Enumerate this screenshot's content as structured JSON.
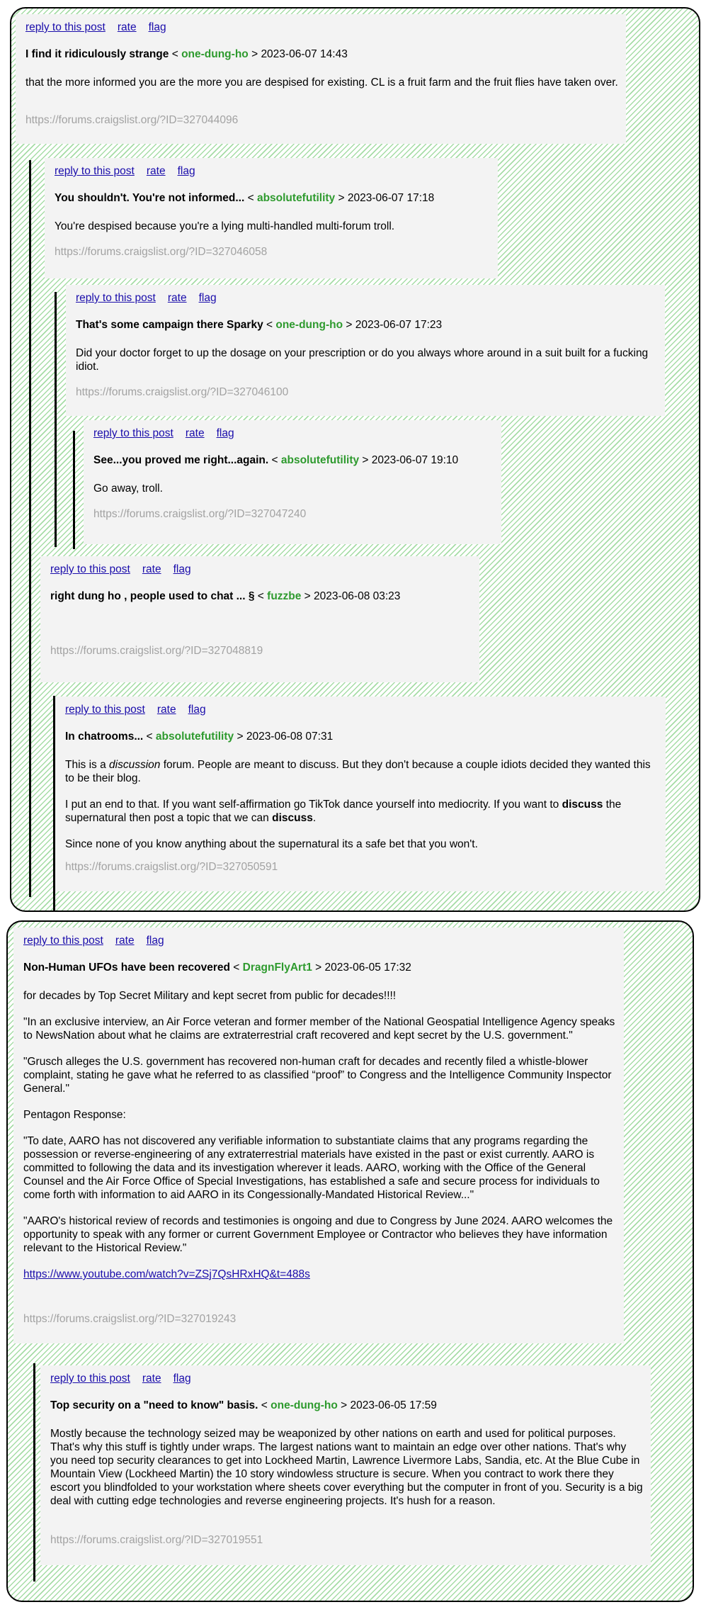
{
  "actions": {
    "reply": "reply to this post",
    "rate": "rate",
    "flag": "flag"
  },
  "threads": [
    {
      "posts": [
        {
          "title": "I find it ridiculously strange",
          "author": "one-dung-ho",
          "datetime": "2023-06-07 14:43",
          "paragraphs": [
            "that the more informed you are the more you are despised for existing. CL is a fruit farm and the fruit flies have taken over."
          ],
          "url": "https://forums.craigslist.org/?ID=327044096"
        },
        {
          "title": "You shouldn't. You're not informed...",
          "author": "absolutefutility",
          "datetime": "2023-06-07 17:18",
          "paragraphs": [
            "You're despised because you're a lying multi-handled multi-forum troll."
          ],
          "url": "https://forums.craigslist.org/?ID=327046058"
        },
        {
          "title": "That's some campaign there Sparky",
          "author": "one-dung-ho",
          "datetime": "2023-06-07 17:23",
          "paragraphs": [
            "Did your doctor forget to up the dosage on your prescription or do you always whore around in a suit built for a fucking idiot."
          ],
          "url": "https://forums.craigslist.org/?ID=327046100"
        },
        {
          "title": "See...you proved me right...again.",
          "author": "absolutefutility",
          "datetime": "2023-06-07 19:10",
          "paragraphs": [
            "Go away, troll."
          ],
          "url": "https://forums.craigslist.org/?ID=327047240"
        },
        {
          "title": "right dung ho , people used to chat ... §",
          "author": "fuzzbe",
          "datetime": "2023-06-08 03:23",
          "paragraphs": [],
          "url": "https://forums.craigslist.org/?ID=327048819"
        },
        {
          "title": "In chatrooms...",
          "author": "absolutefutility",
          "datetime": "2023-06-08 07:31",
          "p1_pre": "This is a ",
          "p1_em": "discussion",
          "p1_post": " forum. People are meant to discuss. But they don't because a couple idiots decided they wanted this to be their blog.",
          "p2_a": "I put an end to that. If you want self-affirmation go TikTok dance yourself into mediocrity. If you want to ",
          "p2_b1": "discuss",
          "p2_c": " the supernatural then post a topic that we can ",
          "p2_b2": "discuss",
          "p2_d": ".",
          "p3": "Since none of you know anything about the supernatural its a safe bet that you won't.",
          "url": "https://forums.craigslist.org/?ID=327050591"
        }
      ]
    },
    {
      "posts": [
        {
          "title": "Non-Human UFOs have been recovered",
          "author": "DragnFlyArt1",
          "datetime": "2023-06-05 17:32",
          "paragraphs": [
            "for decades by Top Secret Military and kept secret from public for decades!!!!",
            "\"In an exclusive interview, an Air Force veteran and former member of the National Geospatial Intelligence Agency speaks to NewsNation about what he claims are extraterrestrial craft recovered and kept secret by the U.S. government.\"",
            "\"Grusch alleges the U.S. government has recovered non-human craft for decades and recently filed a whistle-blower complaint, stating he gave what he referred to as classified “proof” to Congress and the Intelligence Community Inspector General.\"",
            "Pentagon Response:",
            "\"To date, AARO has not discovered any verifiable information to substantiate claims that any programs regarding the possession or reverse-engineering of any extraterrestrial materials have existed in the past or exist currently. AARO is committed to following the data and its investigation wherever it leads. AARO, working with the Office of the General Counsel and the Air Force Office of Special Investigations, has established a safe and secure process for individuals to come forth with information to aid AARO in its Congessionally-Mandated Historical Review...\"",
            "\"AARO's historical review of records and testimonies is ongoing and due to Congress by June 2024. AARO welcomes the opportunity to speak with any former or current Government Employee or Contractor who believes they have information relevant to the Historical Review.\""
          ],
          "link": "https://www.youtube.com/watch?v=ZSj7QsHRxHQ&t=488s",
          "url": "https://forums.craigslist.org/?ID=327019243"
        },
        {
          "title": "Top security on a \"need to know\" basis.",
          "author": "one-dung-ho",
          "datetime": "2023-06-05 17:59",
          "paragraphs": [
            "Mostly because the technology seized may be weaponized by other nations on earth and used for political purposes. That's why this stuff is tightly under wraps. The largest nations want to maintain an edge over other nations. That's why you need top security clearances to get into Lockheed Martin, Lawrence Livermore Labs, Sandia, etc. At the Blue Cube in Mountain View (Lockheed Martin) the 10 story windowless structure is secure. When you contract to work there they escort you blindfolded to your workstation where sheets cover everything but the computer in front of you. Security is a big deal with cutting edge technologies and reverse engineering projects. It's hush for a reason."
          ],
          "url": "https://forums.craigslist.org/?ID=327019551"
        }
      ]
    }
  ]
}
